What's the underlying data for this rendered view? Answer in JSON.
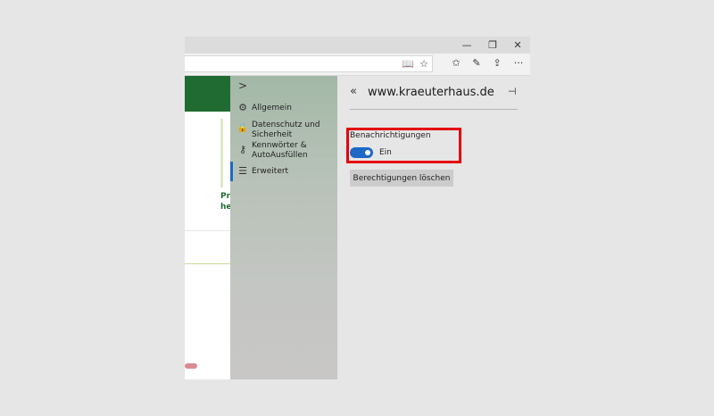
{
  "window": {
    "controls": {
      "minimize": "—",
      "maximize": "❐",
      "close": "✕"
    }
  },
  "toolbar": {
    "reading_view_icon": "📖",
    "favorite_icon": "☆",
    "favorites_hub_icon": "✩",
    "notes_icon": "✎",
    "share_icon": "⇪",
    "more_icon": "···"
  },
  "page": {
    "green_text": [
      "Pr",
      "he"
    ]
  },
  "nav": {
    "collapse_icon": ">",
    "items": [
      {
        "icon": "⚙",
        "label": "Allgemein"
      },
      {
        "icon": "🔒",
        "label": "Datenschutz und\nSicherheit"
      },
      {
        "icon": "⚷",
        "label": "Kennwörter &\nAutoAusfüllen"
      },
      {
        "icon": "☰",
        "label": "Erweitert"
      }
    ]
  },
  "panel": {
    "back_icon": "«",
    "title": "www.kraeuterhaus.de",
    "pin_icon": "⊣",
    "notifications_label": "Benachrichtigungen",
    "toggle_state": "Ein",
    "clear_button": "Berechtigungen löschen"
  },
  "colors": {
    "accent": "#1f68c6",
    "highlight": "#e3000f",
    "brand_green": "#1f6b32"
  }
}
